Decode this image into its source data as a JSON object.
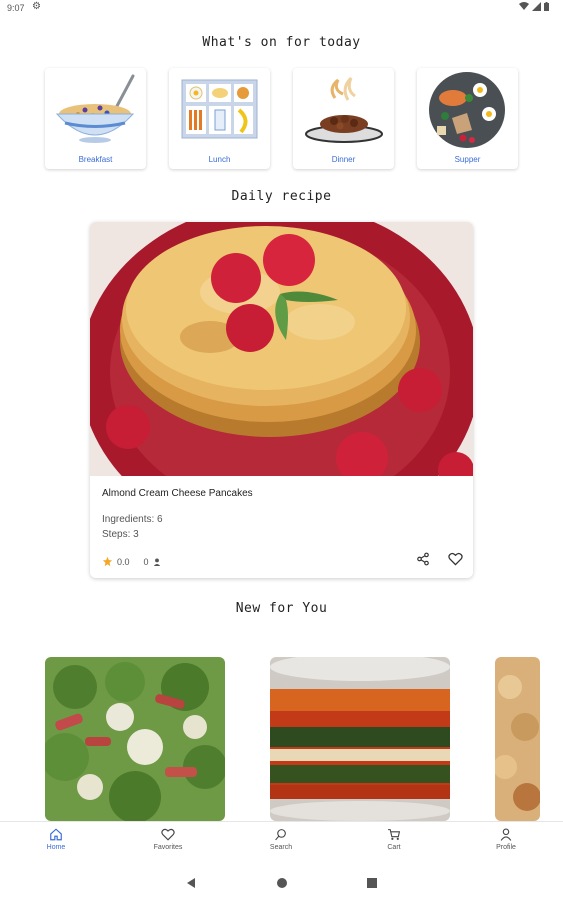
{
  "status": {
    "time": "9:07"
  },
  "sections": {
    "today_title": "What's on for today",
    "daily_title": "Daily recipe",
    "new_title": "New for You"
  },
  "meals": [
    {
      "label": "Breakfast",
      "icon": "cereal-bowl-icon"
    },
    {
      "label": "Lunch",
      "icon": "lunch-tray-icon"
    },
    {
      "label": "Dinner",
      "icon": "dinner-plate-icon"
    },
    {
      "label": "Supper",
      "icon": "supper-platter-icon"
    }
  ],
  "daily_recipe": {
    "name": "Almond Cream Cheese Pancakes",
    "ingredients": "Ingredients: 6",
    "steps": "Steps: 3",
    "rating": "0.0",
    "reviews": "0"
  },
  "nav": [
    {
      "label": "Home",
      "icon": "home-icon",
      "active": true
    },
    {
      "label": "Favorites",
      "icon": "heart-icon",
      "active": false
    },
    {
      "label": "Search",
      "icon": "search-icon",
      "active": false
    },
    {
      "label": "Cart",
      "icon": "cart-icon",
      "active": false
    },
    {
      "label": "Profile",
      "icon": "person-icon",
      "active": false
    }
  ],
  "colors": {
    "accent": "#3b6cd8",
    "star": "#f5a623"
  }
}
